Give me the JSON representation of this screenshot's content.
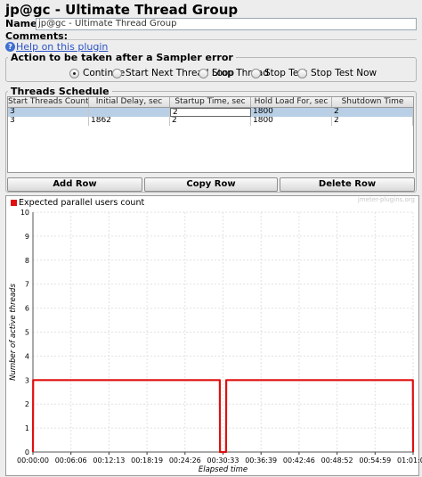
{
  "window": {
    "title": "jp@gc - Ultimate Thread Group"
  },
  "form": {
    "name_label": "Name:",
    "name_value": "jp@gc - Ultimate Thread Group",
    "comments_label": "Comments:",
    "help_link": "Help on this plugin"
  },
  "sampler_error": {
    "legend": "Action to be taken after a Sampler error",
    "options": [
      "Continue",
      "Start Next Thread Loop",
      "Stop Thread",
      "Stop Test",
      "Stop Test Now"
    ],
    "selected": "Continue"
  },
  "schedule": {
    "legend": "Threads Schedule",
    "columns": [
      "Start Threads Count",
      "Initial Delay, sec",
      "Startup Time, sec",
      "Hold Load For, sec",
      "Shutdown Time"
    ],
    "rows": [
      [
        "3",
        "",
        "2",
        "1800",
        "2"
      ],
      [
        "3",
        "1862",
        "2",
        "1800",
        "2"
      ]
    ],
    "buttons": {
      "add": "Add Row",
      "copy": "Copy Row",
      "delete": "Delete Row"
    }
  },
  "chart_data": {
    "type": "line",
    "legend": "Expected parallel users count",
    "watermark": "jmeter-plugins.org",
    "ylabel": "Number of active threads",
    "xlabel": "Elapsed time",
    "ylim": [
      0,
      10
    ],
    "yticks": [
      "0",
      "1",
      "2",
      "3",
      "4",
      "5",
      "6",
      "7",
      "8",
      "9",
      "10"
    ],
    "xticks": [
      "00:00:00",
      "00:06:06",
      "00:12:13",
      "00:18:19",
      "00:24:26",
      "00:30:33",
      "00:36:39",
      "00:42:46",
      "00:48:52",
      "00:54:59",
      "01:01:06"
    ],
    "xlim_sec": [
      0,
      3666
    ],
    "series": [
      {
        "name": "Expected parallel users count",
        "color": "#e01010",
        "x_sec": [
          0,
          2,
          1802,
          1804,
          1862,
          1864,
          3664,
          3666
        ],
        "y": [
          0,
          3,
          3,
          0,
          0,
          3,
          3,
          0
        ]
      }
    ]
  }
}
